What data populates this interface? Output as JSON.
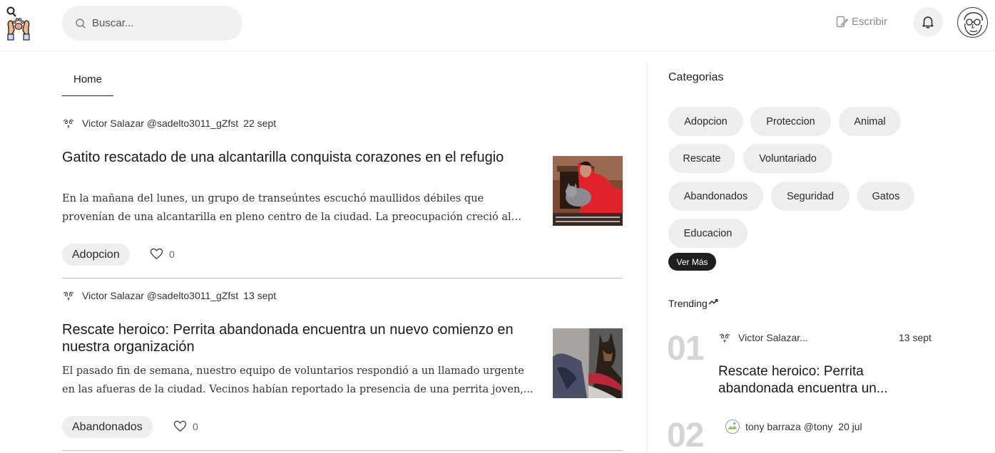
{
  "header": {
    "search_placeholder": "Buscar...",
    "write_label": "Escribir"
  },
  "tabs": {
    "home_label": "Home"
  },
  "articles": [
    {
      "author": "Victor Salazar",
      "handle": "@sadelto3011_gZfst",
      "date": "22 sept",
      "title": "Gatito rescatado de una alcantarilla conquista corazones en el refugio",
      "excerpt": "En la mañana del lunes, un grupo de transeúntes escuchó maullidos débiles que provenían de una alcantarilla en pleno centro de la ciudad. La preocupación creció al notar que los sonid...",
      "tag": "Adopcion",
      "likes": "0"
    },
    {
      "author": "Victor Salazar",
      "handle": "@sadelto3011_gZfst",
      "date": "13 sept",
      "title": "Rescate heroico: Perrita abandonada encuentra un nuevo comienzo en nuestra organización",
      "excerpt": "El pasado fin de semana, nuestro equipo de voluntarios respondió a un llamado urgente en las afueras de la ciudad. Vecinos habían reportado la presencia de una perrita joven,...",
      "tag": "Abandonados",
      "likes": "0"
    }
  ],
  "sidebar": {
    "categories_title": "Categorias",
    "categories": [
      "Adopcion",
      "Proteccion",
      "Animal",
      "Rescate",
      "Voluntariado",
      "Abandonados",
      "Seguridad",
      "Gatos",
      "Educacion"
    ],
    "see_more_label": "Ver Más",
    "trending_title": "Trending",
    "trending": [
      {
        "rank": "01",
        "author": "Victor Salazar...",
        "date": "13 sept",
        "title": "Rescate heroico: Perrita abandonada encuentra un..."
      },
      {
        "rank": "02",
        "author": "tony barraza",
        "handle": "@tony",
        "date": "20 jul"
      }
    ]
  },
  "icons": {
    "logo": "paw-hands-magnifier-logo",
    "search": "search-icon",
    "write": "edit-icon",
    "bell": "bell-icon",
    "avatar": "face-sketch-avatar",
    "like": "heart-icon",
    "trending": "trending-up-icon"
  },
  "colors": {
    "chip_bg": "#eeeeee",
    "ver_mas_bg": "#1f1f1f",
    "trending_number": "#d5d5d5"
  }
}
